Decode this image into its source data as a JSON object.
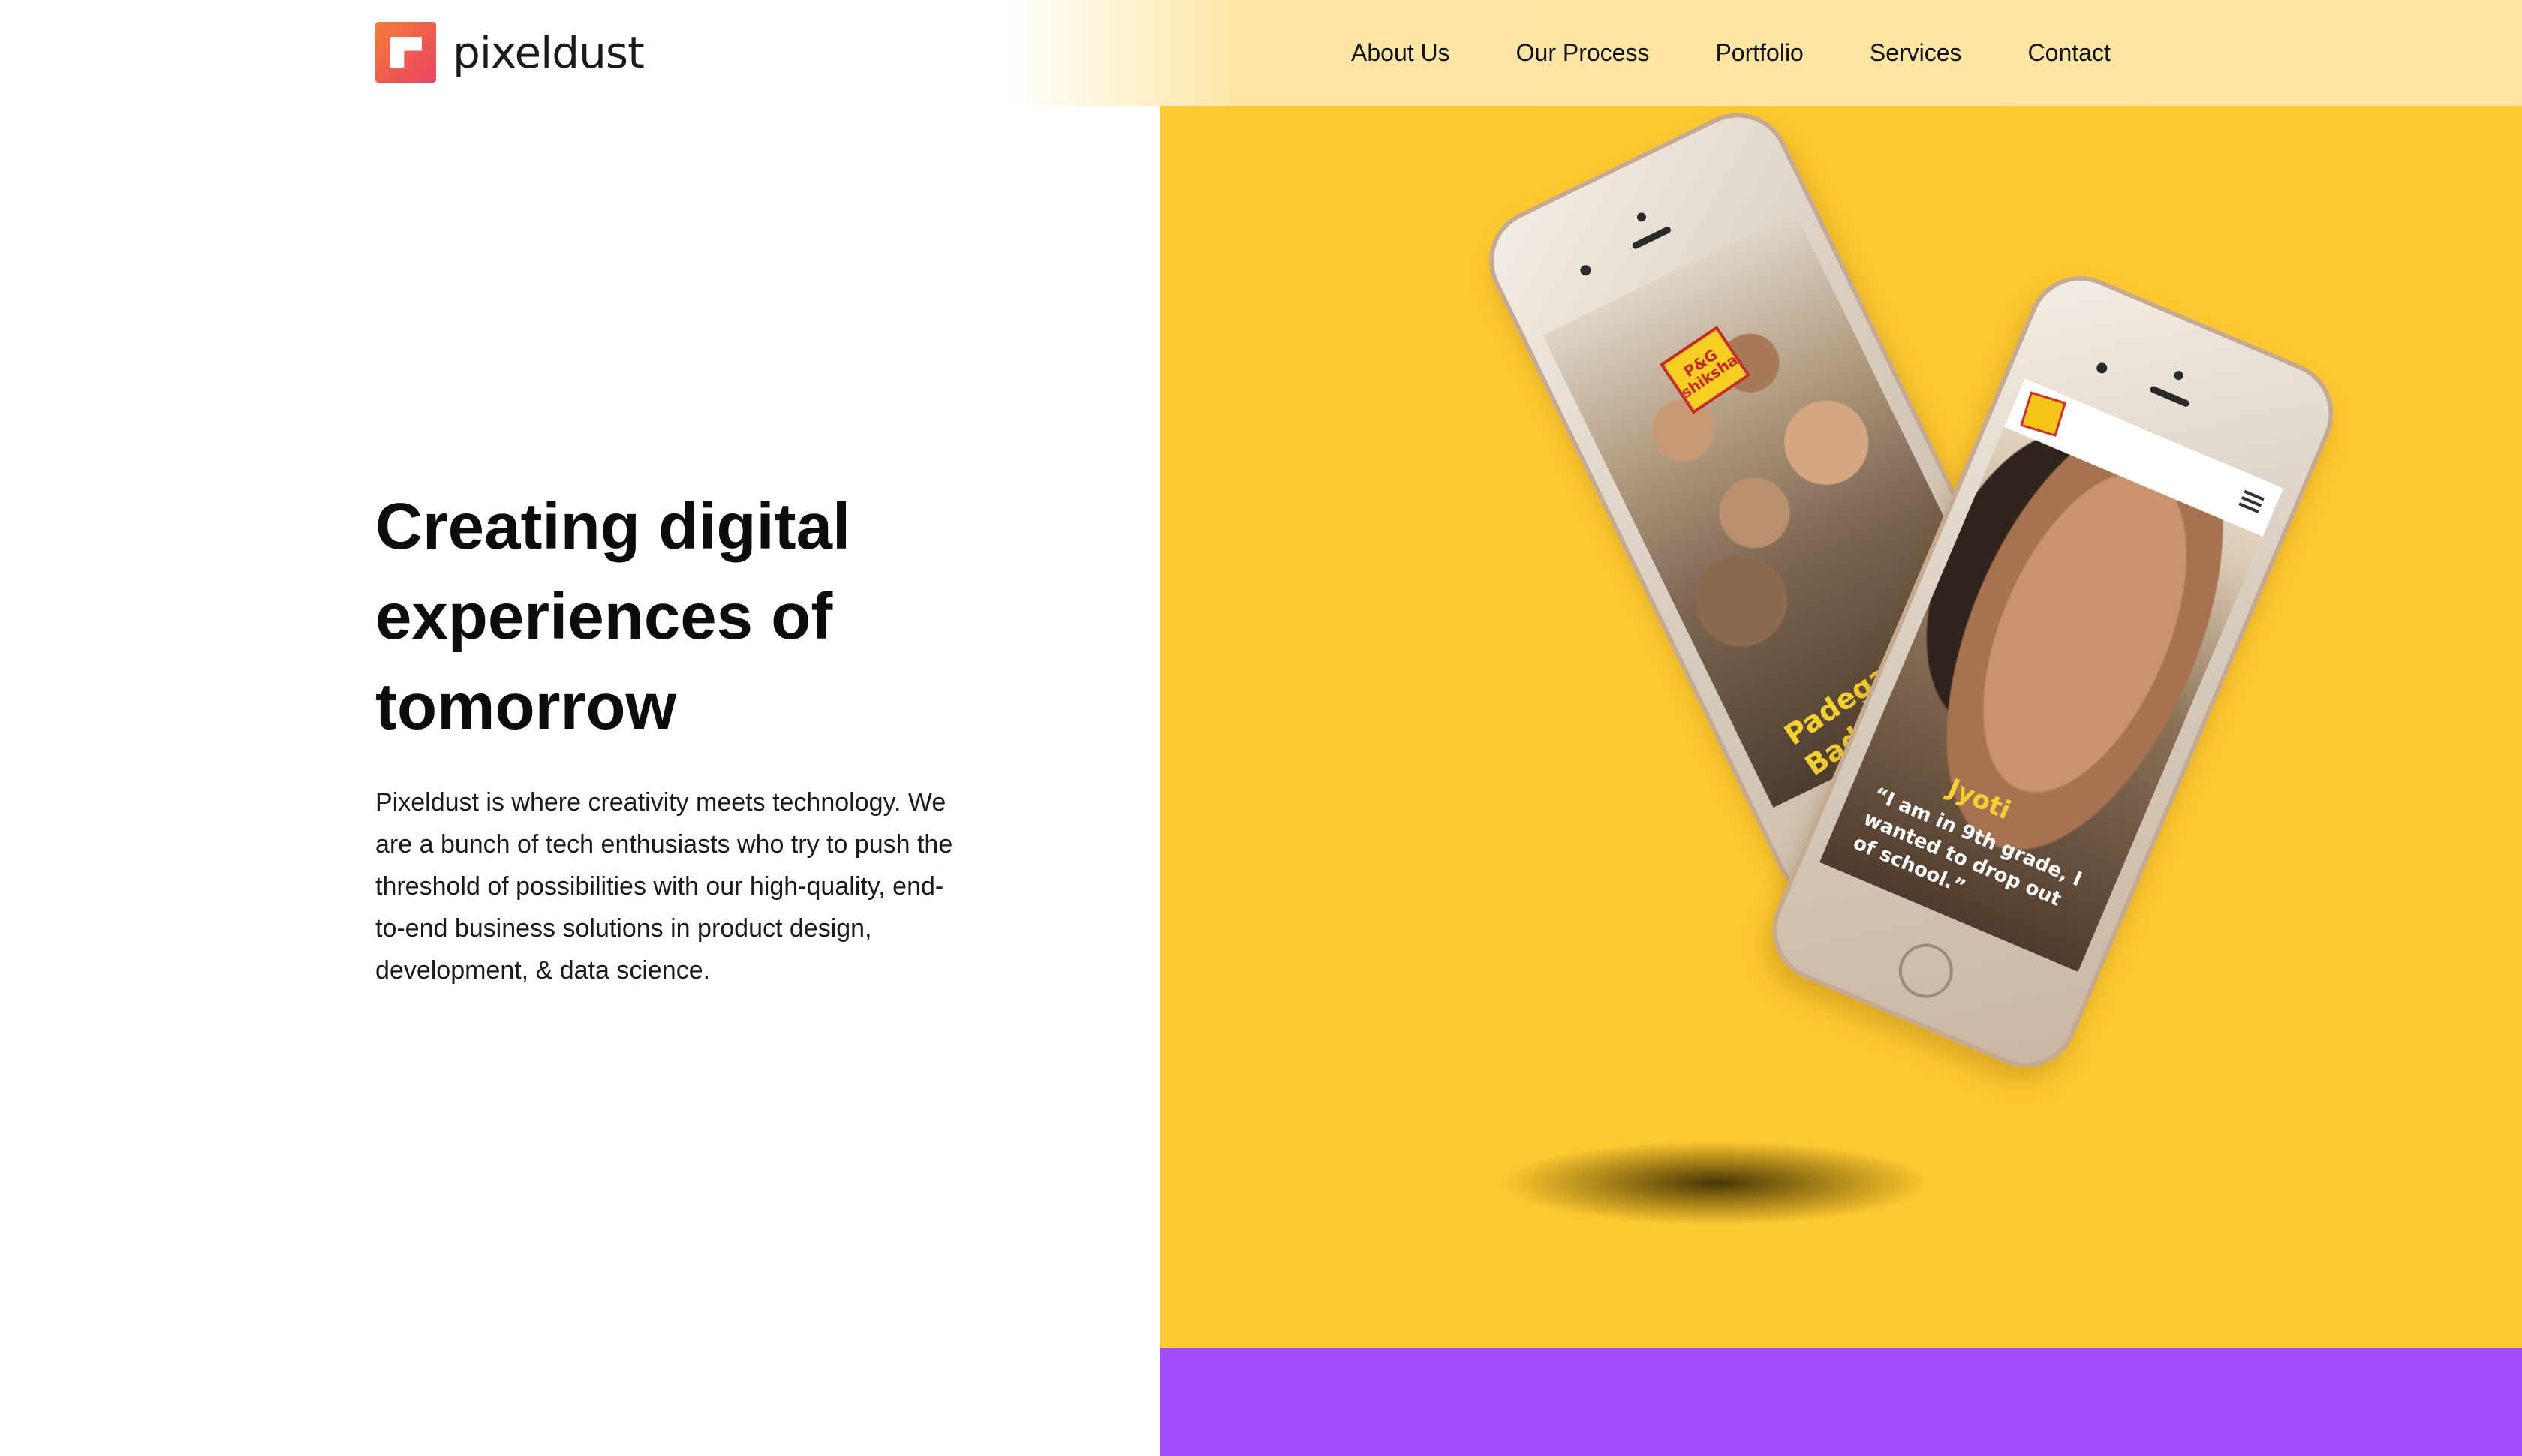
{
  "brand": {
    "name": "pixeldust",
    "logo_icon": "pixeldust-logo-mark",
    "accent": "#ef5a4e"
  },
  "nav": {
    "items": [
      {
        "label": "About Us"
      },
      {
        "label": "Our Process"
      },
      {
        "label": "Portfolio"
      },
      {
        "label": "Services"
      },
      {
        "label": "Contact"
      }
    ]
  },
  "hero": {
    "title": "Creating digital experiences of tomorrow",
    "description": "Pixeldust is where creativity meets technology. We are a bunch of tech enthusiasts who try to push the threshold of possibilities with our high-quality, end-to-end business solutions in product design, development, & data science."
  },
  "showcase": {
    "background_color": "#fec830",
    "band_color": "#a24bfd",
    "back_phone": {
      "badge": "P&G shiksha",
      "headline": "Padega India Badega India"
    },
    "front_phone": {
      "name": "Jyoti",
      "quote": "“I am in 9th grade, I wanted to drop out of school.”"
    }
  }
}
